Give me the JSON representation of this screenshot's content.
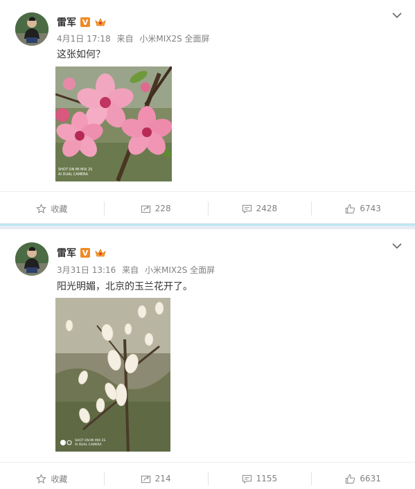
{
  "posts": [
    {
      "user": {
        "name": "雷军",
        "verified_badge": "V"
      },
      "time": "4月1日 17:18",
      "source_prefix": "来自",
      "source": "小米MIX2S 全面屏",
      "text": "这张如何？",
      "photo_watermark": [
        "SHOT ON MI MIX 2S",
        "AI DUAL CAMERA"
      ],
      "actions": {
        "favorite": "收藏",
        "repost": "228",
        "comment": "2428",
        "like": "6743"
      }
    },
    {
      "user": {
        "name": "雷军",
        "verified_badge": "V"
      },
      "time": "3月31日 13:16",
      "source_prefix": "来自",
      "source": "小米MIX2S 全面屏",
      "text": "阳光明媚，北京的玉兰花开了。",
      "photo_watermark": [
        "SHOT ON MI MIX 2S",
        "AI DUAL CAMERA"
      ],
      "actions": {
        "favorite": "收藏",
        "repost": "214",
        "comment": "1155",
        "like": "6631"
      }
    }
  ],
  "colors": {
    "accent": "#f08a24",
    "text": "#333333",
    "muted": "#808080",
    "separator": "#bfe6f4"
  },
  "icons": [
    "chevron-down-icon",
    "star-icon",
    "repost-icon",
    "comment-icon",
    "thumbs-up-icon",
    "vip-crown-icon"
  ]
}
